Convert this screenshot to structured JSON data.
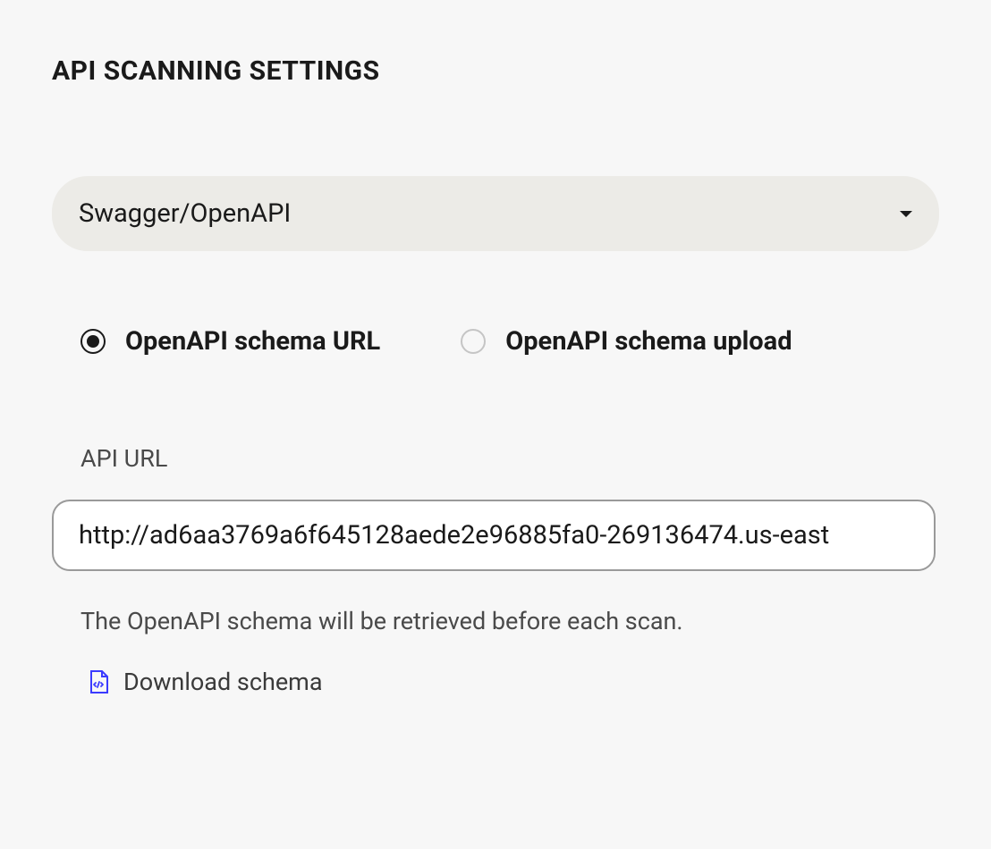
{
  "title": "API SCANNING SETTINGS",
  "dropdown": {
    "selected": "Swagger/OpenAPI"
  },
  "radio": {
    "options": [
      {
        "label": "OpenAPI schema URL",
        "selected": true
      },
      {
        "label": "OpenAPI schema upload",
        "selected": false
      }
    ]
  },
  "field": {
    "label": "API URL",
    "value": "http://ad6aa3769a6f645128aede2e96885fa0-269136474.us-east",
    "helper": "The OpenAPI schema will be retrieved before each scan."
  },
  "download": {
    "label": "Download schema"
  }
}
